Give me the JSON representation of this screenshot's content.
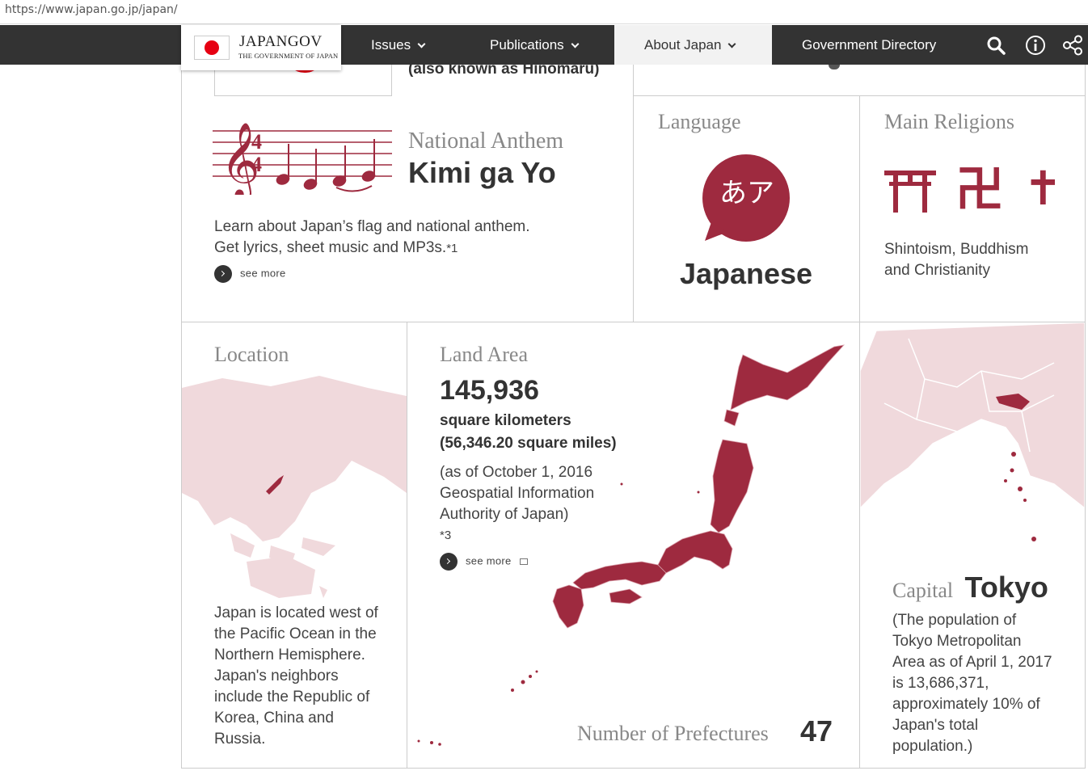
{
  "browser": {
    "url": "https://www.japan.go.jp/japan/"
  },
  "header": {
    "logo_title": "JAPANGOV",
    "logo_subtitle": "THE GOVERNMENT OF JAPAN",
    "nav": [
      {
        "label": "Issues"
      },
      {
        "label": "Publications"
      },
      {
        "label": "About Japan"
      },
      {
        "label": "Government Directory"
      }
    ],
    "icons": [
      "search-icon",
      "info-icon",
      "share-icon"
    ]
  },
  "colors": {
    "accent": "#9e2a3f",
    "map_light": "#f0d9dc",
    "nav_bg": "#333333"
  },
  "flag": {
    "caption_partial": "(also known as Hinomaru)"
  },
  "anthem": {
    "label": "National Anthem",
    "name": "Kimi ga Yo",
    "desc_line1": "Learn about Japan’s flag and national anthem.",
    "desc_line2": "Get lyrics, sheet music and MP3s.",
    "footnote": "*1",
    "see_more": "see more",
    "time_signature_top": "4",
    "time_signature_bottom": "4"
  },
  "language": {
    "label": "Language",
    "bubble_text": "あア",
    "value": "Japanese"
  },
  "religions": {
    "label": "Main Religions",
    "icons": [
      "torii-icon",
      "manji-icon",
      "cross-icon"
    ],
    "glyph_manji": "卍",
    "glyph_cross": "✝",
    "desc_line1": "Shintoism, Buddhism",
    "desc_line2": "and Christianity"
  },
  "location": {
    "label": "Location",
    "lines": [
      "Japan is located west of",
      "the Pacific Ocean in the",
      "Northern Hemisphere.",
      "Japan's neighbors",
      "include the Republic of",
      "Korea, China and",
      "Russia."
    ]
  },
  "land_area": {
    "label": "Land Area",
    "value": "145,936",
    "unit": "square kilometers",
    "miles": "(56,346.20 square miles)",
    "note_lines": [
      "(as of October 1, 2016",
      "Geospatial Information",
      "Authority of Japan)"
    ],
    "footnote": "*3",
    "see_more": "see more"
  },
  "prefectures": {
    "label": "Number of Prefectures",
    "value": "47"
  },
  "capital": {
    "label": "Capital",
    "value": "Tokyo",
    "lines": [
      "(The population of",
      "Tokyo Metropolitan",
      "Area as of April 1, 2017",
      "is 13,686,371,",
      "approximately 10% of",
      "Japan's total",
      "population.)"
    ]
  }
}
